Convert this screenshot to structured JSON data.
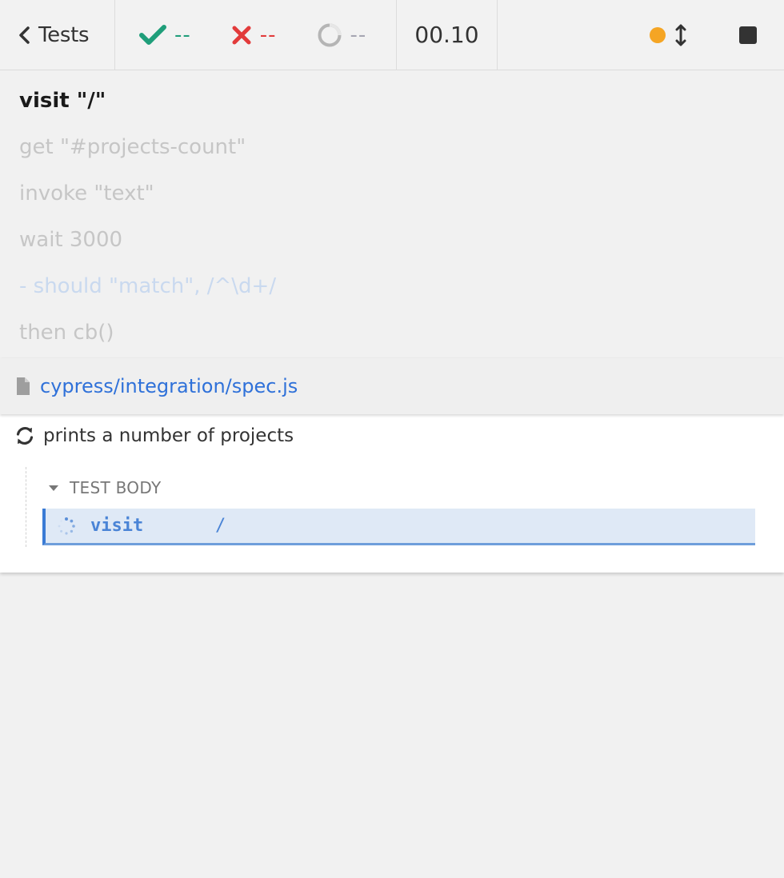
{
  "header": {
    "back_label": "Tests",
    "passed": "--",
    "failed": "--",
    "pending": "--",
    "duration": "00.10",
    "colors": {
      "passed": "#1f9e7a",
      "failed": "#e23b3b",
      "pending": "#a6a6b2",
      "running_dot": "#f5a524"
    },
    "icons": [
      "chevron-left-icon",
      "check-icon",
      "x-icon",
      "pending-circle-icon",
      "resize-arrows-icon",
      "stop-icon"
    ]
  },
  "overlay_commands": [
    "visit \"/\"",
    "get \"#projects-count\"",
    "invoke \"text\"",
    "wait 3000",
    "- should \"match\", /^\\d+/",
    "then cb()"
  ],
  "spec": {
    "path": "cypress/integration/spec.js",
    "test_title": "prints a number of projects",
    "hook_label": "TEST BODY",
    "command": {
      "method": "visit",
      "message": "/"
    }
  }
}
